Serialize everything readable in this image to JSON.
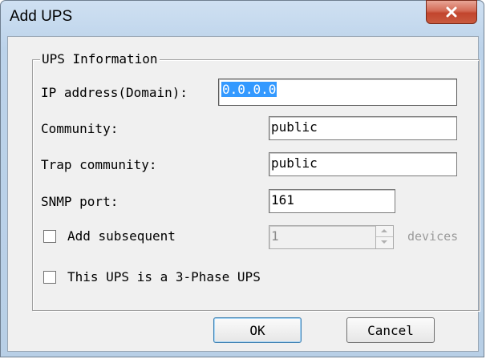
{
  "window": {
    "title": "Add UPS"
  },
  "group": {
    "label": "UPS Information"
  },
  "fields": {
    "ip": {
      "label": "IP address(Domain):",
      "value": "0.0.0.0"
    },
    "community": {
      "label": "Community:",
      "value": "public"
    },
    "trap": {
      "label": "Trap community:",
      "value": "public"
    },
    "snmp": {
      "label": "SNMP port:",
      "value": "161"
    }
  },
  "subsequent": {
    "label": "Add subsequent",
    "value": "1",
    "suffix": "devices",
    "checked": false
  },
  "three_phase": {
    "label": "This UPS is a 3-Phase UPS",
    "checked": false
  },
  "buttons": {
    "ok": "OK",
    "cancel": "Cancel"
  },
  "colors": {
    "selection": "#3399ff",
    "close_button": "#c2452d",
    "frame": "#bcd3ea"
  }
}
